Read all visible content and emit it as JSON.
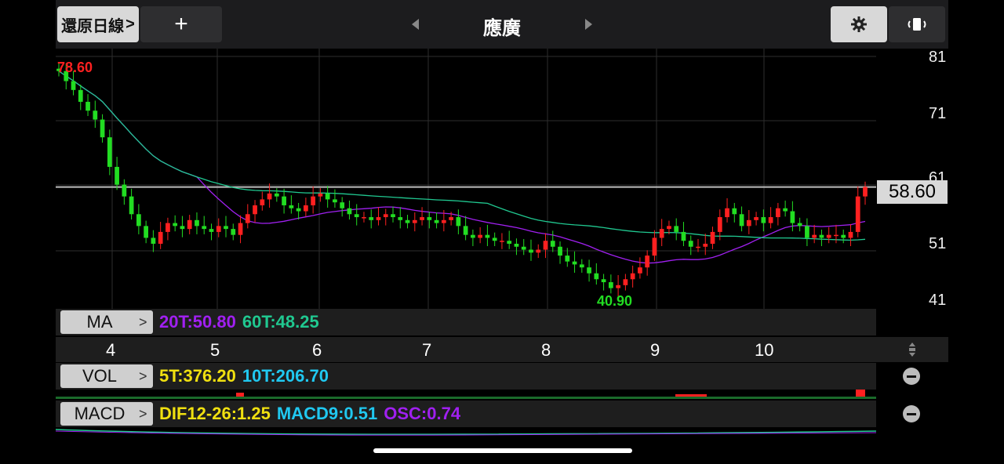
{
  "header": {
    "restore_label": "還原日線",
    "add_label": "+",
    "stock_name": "應廣"
  },
  "price_axis": [
    "81",
    "71",
    "61",
    "51",
    "41"
  ],
  "current_price": "58.60",
  "annotations": {
    "high": "78.60",
    "low": "40.90"
  },
  "ma": {
    "label": "MA",
    "v1": "20T:50.80",
    "v2": "60T:48.25"
  },
  "vol": {
    "label": "VOL",
    "v1": "5T:376.20",
    "v2": "10T:206.70"
  },
  "macd": {
    "label": "MACD",
    "v1": "DIF12-26:1.25",
    "v2": "MACD9:0.51",
    "v3": "OSC:0.74"
  },
  "months": [
    "4",
    "5",
    "6",
    "7",
    "8",
    "9",
    "10"
  ],
  "colors": {
    "up": "#ff2020",
    "down": "#22dd22",
    "ma20": "#a020f0",
    "ma60": "#20c890",
    "vol_yellow": "#f0e010",
    "macd_cyan": "#20c8f0"
  },
  "chart_data": {
    "type": "candlestick",
    "x": [
      "4",
      "5",
      "6",
      "7",
      "8",
      "9",
      "10"
    ],
    "ylim": [
      38,
      82
    ],
    "close": [
      78.2,
      76.5,
      75.0,
      73.0,
      71.5,
      70.0,
      67.0,
      62.0,
      59.0,
      57.0,
      54.0,
      52.0,
      50.0,
      49.0,
      51.0,
      52.5,
      52.0,
      51.5,
      53.0,
      52.0,
      51.5,
      51.0,
      52.0,
      51.5,
      50.5,
      52.5,
      54.0,
      55.5,
      56.5,
      57.5,
      57.0,
      55.5,
      55.0,
      54.5,
      55.5,
      57.0,
      57.5,
      56.5,
      56.0,
      55.0,
      54.0,
      53.5,
      53.5,
      53.0,
      53.5,
      54.0,
      53.5,
      53.0,
      52.5,
      53.0,
      53.5,
      53.0,
      52.5,
      53.0,
      53.5,
      52.0,
      50.5,
      50.0,
      50.5,
      50.0,
      49.5,
      49.5,
      49.0,
      48.5,
      48.0,
      47.5,
      48.0,
      49.5,
      48.5,
      47.0,
      46.0,
      45.5,
      45.0,
      44.0,
      43.0,
      42.5,
      41.5,
      42.0,
      43.0,
      44.0,
      45.0,
      47.0,
      50.0,
      51.5,
      52.0,
      51.0,
      49.5,
      48.5,
      48.5,
      49.0,
      51.0,
      53.5,
      55.0,
      54.0,
      52.0,
      53.0,
      53.5,
      52.5,
      53.5,
      55.0,
      54.5,
      52.5,
      52.0,
      50.0,
      50.5,
      50.0,
      50.5,
      50.5,
      50.0,
      51.0,
      57.0,
      58.6
    ]
  }
}
